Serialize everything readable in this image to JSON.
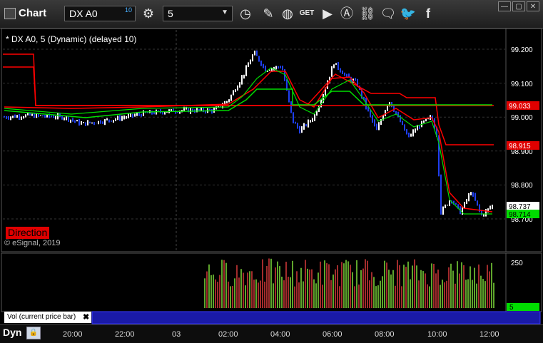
{
  "toolbar": {
    "title": "Chart",
    "symbol": "DX A0",
    "symbol_superscript": "10",
    "interval": "5",
    "icons": [
      "gear-icon",
      "clock-icon",
      "pencil-icon",
      "study-icon",
      "get-icon",
      "play-icon",
      "alert-icon",
      "link-icon",
      "chat-icon",
      "twitter-icon",
      "facebook-icon"
    ],
    "window_buttons": [
      "minimize",
      "maximize",
      "close"
    ]
  },
  "chart": {
    "header": "* DX A0, 5 (Dynamic) (delayed 10)",
    "copyright": "© eSignal, 2019",
    "direction_label": "Direction",
    "price_ticks": [
      "99.200",
      "99.100",
      "99.000",
      "98.900",
      "98.800",
      "98.700"
    ],
    "price_markers": [
      {
        "value": "99.033",
        "color": "#e00000"
      },
      {
        "value": "98.915",
        "color": "#e00000"
      },
      {
        "value": "98.737",
        "color": "#ffffff"
      },
      {
        "value": "98.714",
        "color": "#00dd00"
      }
    ],
    "volume_tick": "250",
    "volume_marker": "5"
  },
  "volume_panel": {
    "label": "Vol (current price bar)"
  },
  "bottom": {
    "mode": "Dyn",
    "time_labels": [
      "20:00",
      "22:00",
      "03",
      "02:00",
      "04:00",
      "06:00",
      "08:00",
      "10:00",
      "12:00"
    ]
  },
  "colors": {
    "up_bar": "#ffffff",
    "down_bar": "#1f3ff0",
    "ma_red": "#ff0000",
    "ma_green": "#00dd00",
    "accent_blue": "#1a1aa8"
  }
}
